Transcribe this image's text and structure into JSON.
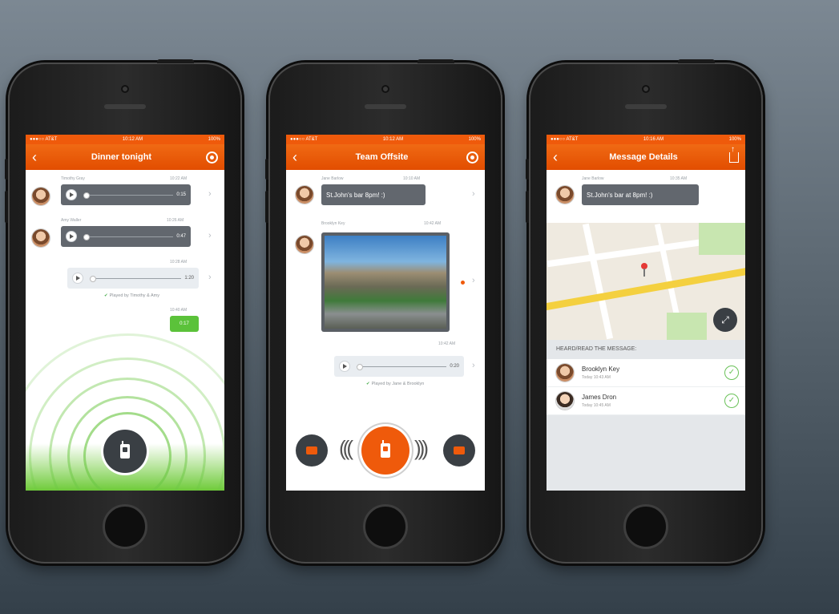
{
  "status": {
    "carrier": "●●●○○ AT&T",
    "time": "10:12 AM",
    "battery": "100%",
    "time3": "10:16 AM"
  },
  "phone1": {
    "title": "Dinner tonight",
    "messages": [
      {
        "sender": "Timothy Gray",
        "time": "10:22 AM",
        "duration": "0:15"
      },
      {
        "sender": "Amy Waller",
        "time": "10:26 AM",
        "duration": "0:47"
      },
      {
        "time": "10:28 AM",
        "duration": "1:20",
        "played": "Played by Timothy & Amy"
      },
      {
        "time": "10:40 AM",
        "duration": "0:17"
      }
    ]
  },
  "phone2": {
    "title": "Team Offsite",
    "msg1": {
      "sender": "Jane Barlow",
      "time": "10:10 AM",
      "text": "St.John's bar 8pm! :)"
    },
    "msg2": {
      "sender": "Brooklyn Key",
      "time": "10:42 AM"
    },
    "msg3": {
      "time": "10:42 AM",
      "duration": "0:20",
      "played": "Played by Jane & Brooklyn"
    }
  },
  "phone3": {
    "title": "Message Details",
    "msg": {
      "sender": "Jane Barlow",
      "time": "10:35 AM",
      "text": "St.John's bar at 8pm! :)"
    },
    "section_header": "HEARD/READ THE MESSAGE:",
    "readers": [
      {
        "name": "Brooklyn Key",
        "time": "Today 10:43 AM"
      },
      {
        "name": "James Dron",
        "time": "Today 10:45 AM"
      }
    ]
  }
}
